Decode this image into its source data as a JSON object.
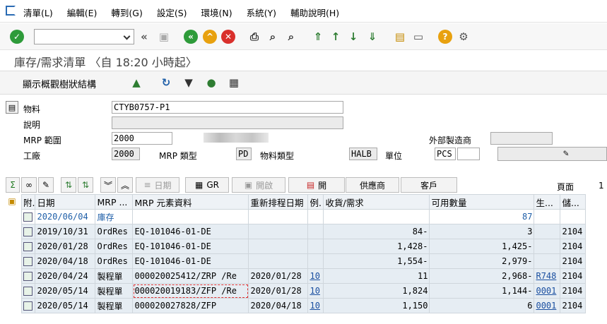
{
  "menu": [
    "清單(L)",
    "編輯(E)",
    "轉到(G)",
    "設定(S)",
    "環境(N)",
    "系統(Y)",
    "輔助說明(H)"
  ],
  "title": "庫存/需求清單 〈自 18:20 小時起〉",
  "app_button": "顯示概觀樹狀結構",
  "header": {
    "material_label": "物料",
    "material_value": "CTYB0757-P1",
    "description_label": "說明",
    "mrp_area_label": "MRP 範圍",
    "mrp_area_value": "2000",
    "external_label": "外部製造商",
    "plant_label": "工廠",
    "plant_value": "2000",
    "mrp_type_label": "MRP 類型",
    "mrp_type_value": "PD",
    "material_type_label": "物料類型",
    "material_type_value": "HALB",
    "unit_label": "單位",
    "unit_value": "PCS"
  },
  "table_toolbar": {
    "date": "日期",
    "gr": "GR",
    "open_obj": "開啟",
    "open": "開",
    "vendor": "供應商",
    "customer": "客戶",
    "page_label": "頁面",
    "page_value": "1"
  },
  "columns": [
    "附.",
    "日期",
    "MRP ...",
    "MRP 元素資料",
    "重新排程日期",
    "例.",
    "收貨/需求",
    "可用數量",
    "生...",
    "儲..."
  ],
  "rows": [
    {
      "date": "2020/06/04",
      "mrp": "庫存",
      "elem": "",
      "resched": "",
      "ex": "",
      "recv": "",
      "avail": "87",
      "prod": "",
      "stor": ""
    },
    {
      "date": "2019/10/31",
      "mrp": "OrdRes",
      "elem": "EQ-101046-01-DE",
      "resched": "",
      "ex": "",
      "recv": "84-",
      "avail": "3",
      "prod": "",
      "stor": "2104"
    },
    {
      "date": "2020/01/28",
      "mrp": "OrdRes",
      "elem": "EQ-101046-01-DE",
      "resched": "",
      "ex": "",
      "recv": "1,428-",
      "avail": "1,425-",
      "prod": "",
      "stor": "2104"
    },
    {
      "date": "2020/04/18",
      "mrp": "OrdRes",
      "elem": "EQ-101046-01-DE",
      "resched": "",
      "ex": "",
      "recv": "1,554-",
      "avail": "2,979-",
      "prod": "",
      "stor": "2104"
    },
    {
      "date": "2020/04/24",
      "mrp": "製程單",
      "elem": "000020025412/ZRP /Re",
      "resched": "2020/01/28",
      "ex": "10",
      "recv": "11",
      "avail": "2,968-",
      "prod": "R748",
      "stor": "2104"
    },
    {
      "date": "2020/05/14",
      "mrp": "製程單",
      "elem": "000020019183/ZFP /Re",
      "resched": "2020/01/28",
      "ex": "10",
      "recv": "1,824",
      "avail": "1,144-",
      "prod": "0001",
      "stor": "2104"
    },
    {
      "date": "2020/05/14",
      "mrp": "製程單",
      "elem": "000020027828/ZFP",
      "resched": "2020/04/18",
      "ex": "10",
      "recv": "1,150",
      "avail": "6",
      "prod": "0001",
      "stor": "2104"
    }
  ]
}
